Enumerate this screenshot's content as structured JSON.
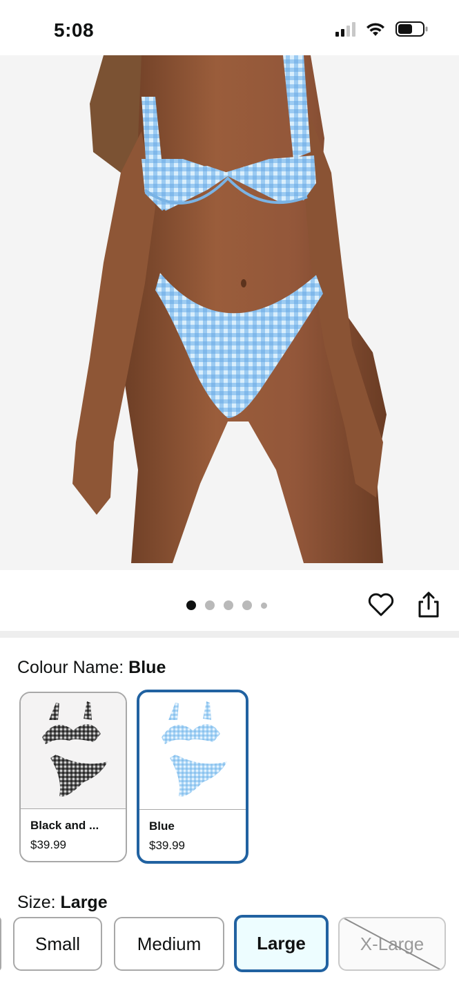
{
  "status_bar": {
    "time": "5:08",
    "icons": [
      "cellular-signal-icon",
      "wifi-icon",
      "battery-icon"
    ]
  },
  "product_image": {
    "description_icon": "product-photo",
    "carousel": {
      "total_dots": 5,
      "active_index": 0
    }
  },
  "actions": {
    "icons": [
      "heart-icon",
      "share-icon"
    ]
  },
  "colour": {
    "label": "Colour Name: ",
    "selected": "Blue",
    "options": [
      {
        "name": "Black and ...",
        "price": "$39.99",
        "color": "#3a3a3a"
      },
      {
        "name": "Blue",
        "price": "$39.99",
        "color": "#a9d4f5"
      }
    ]
  },
  "size": {
    "label": "Size: ",
    "selected": "Large",
    "options": [
      {
        "label": "Small",
        "state": "available"
      },
      {
        "label": "Medium",
        "state": "available"
      },
      {
        "label": "Large",
        "state": "selected"
      },
      {
        "label": "X-Large",
        "state": "unavailable"
      }
    ]
  },
  "colors": {
    "accent": "#2162a1",
    "selected_bg": "#edfdff",
    "border": "#a8a8a8",
    "text": "#0f1111"
  }
}
